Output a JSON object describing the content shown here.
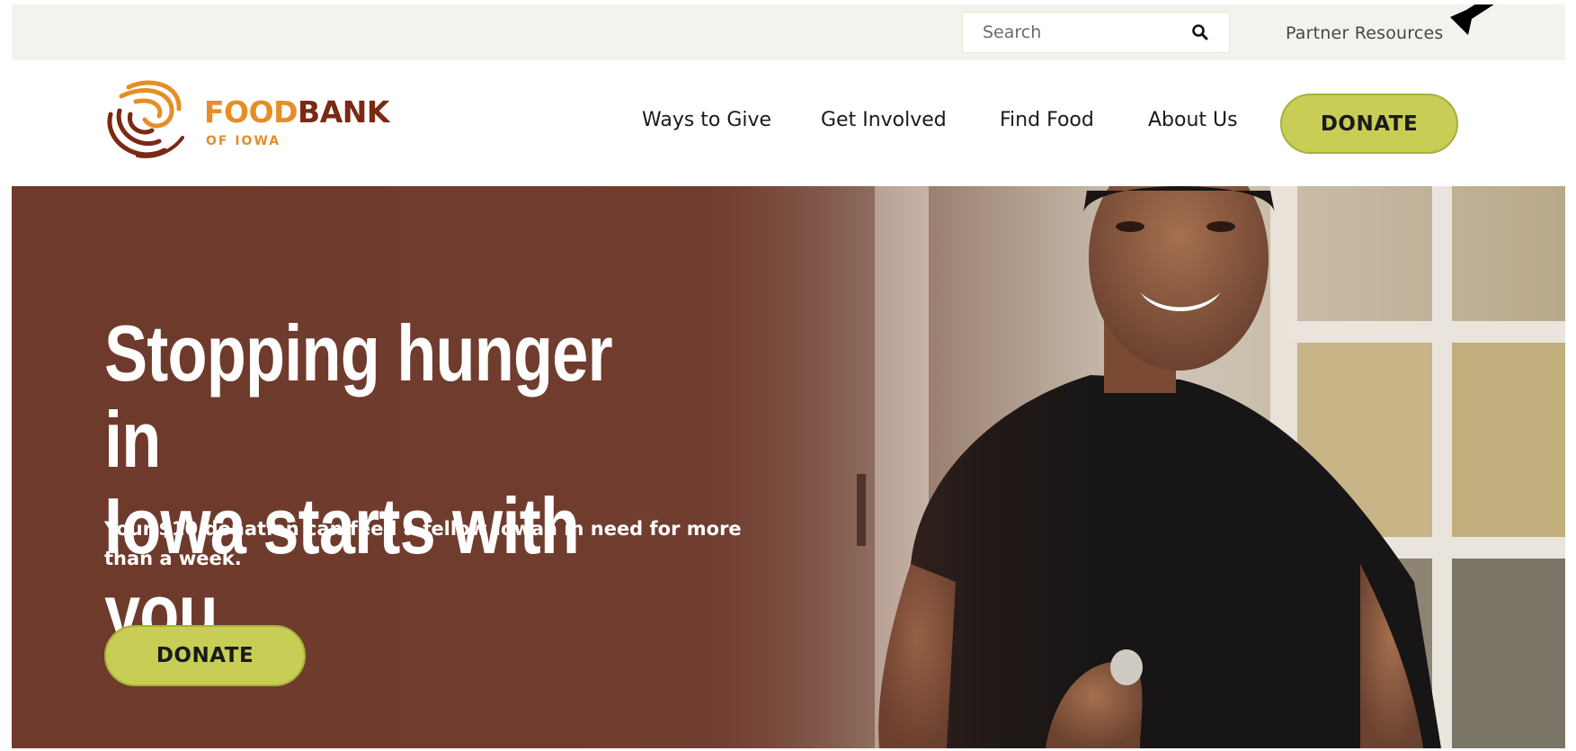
{
  "topbar": {
    "search_placeholder": "Search",
    "search_icon": "search-icon",
    "partner_resources": "Partner Resources"
  },
  "logo": {
    "word_part1": "FOOD",
    "word_part2": "BANK",
    "subtitle": "OF IOWA",
    "colors": {
      "orange": "#e58e27",
      "maroon": "#7a2914"
    }
  },
  "nav": {
    "items": [
      {
        "label": "Ways to Give"
      },
      {
        "label": "Get Involved"
      },
      {
        "label": "Find Food"
      },
      {
        "label": "About Us"
      }
    ],
    "donate_label": "DONATE"
  },
  "hero": {
    "title_line1": "Stopping hunger in",
    "title_line2": "Iowa starts with you",
    "subtitle": "Your $10 donation can feed a fellow Iowan in need for more than a week.",
    "donate_label": "DONATE",
    "colors": {
      "overlay": "#6e3a2c",
      "button": "#c7cd55"
    }
  }
}
